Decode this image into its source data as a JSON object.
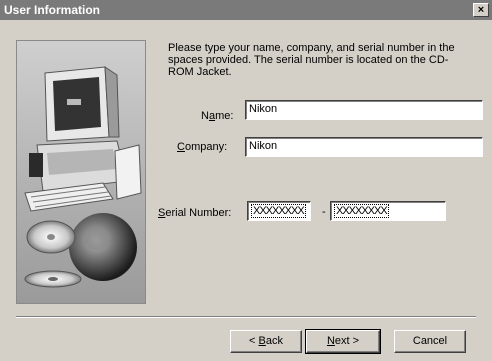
{
  "window": {
    "title": "User Information",
    "close_glyph": "×"
  },
  "instructions": "Please type your name, company, and serial number in the spaces provided. The serial number is located on the CD-ROM Jacket.",
  "fields": {
    "name": {
      "label_pre": "N",
      "label_mnemonic": "a",
      "label_post": "me:",
      "value": "Nikon"
    },
    "company": {
      "label_pre": "",
      "label_mnemonic": "C",
      "label_post": "ompany:",
      "value": "Nikon"
    },
    "serial": {
      "label_pre": "",
      "label_mnemonic": "S",
      "label_post": "erial Number:",
      "part1": "XXXXXXXX",
      "separator": "-",
      "part2": "XXXXXXXX"
    }
  },
  "buttons": {
    "back": {
      "pre": "< ",
      "mnemonic": "B",
      "post": "ack"
    },
    "next": {
      "pre": "",
      "mnemonic": "N",
      "post": "ext >"
    },
    "cancel": {
      "pre": "",
      "mnemonic": "",
      "post": "Cancel"
    }
  },
  "illustration": {
    "icon": "computer-with-cd-illustration"
  }
}
